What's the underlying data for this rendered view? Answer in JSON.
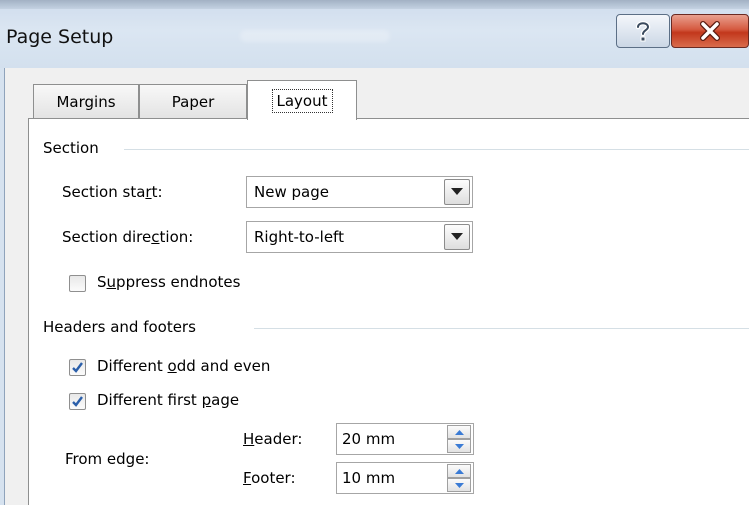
{
  "window": {
    "title": "Page Setup",
    "help_glyph": "?",
    "close_glyph": "X",
    "icons": {
      "help": "help-icon",
      "close": "close-icon"
    },
    "colors": {
      "accent": "#d55a40",
      "titlebar": "#d6e2ef",
      "check": "#2b5faa"
    }
  },
  "tabs": [
    {
      "label": "Margins",
      "active": false
    },
    {
      "label": "Paper",
      "active": false
    },
    {
      "label": "Layout",
      "active": true
    }
  ],
  "section": {
    "heading": "Section",
    "start": {
      "label_pre": "Section sta",
      "label_key": "r",
      "label_post": "t:",
      "value": "New page"
    },
    "direction": {
      "label_pre": "Section dire",
      "label_key": "c",
      "label_post": "tion:",
      "value": "Right-to-left"
    },
    "suppress": {
      "label_pre": "S",
      "label_key": "u",
      "label_post": "ppress endnotes",
      "checked": false
    }
  },
  "headers_footers": {
    "heading": "Headers and footers",
    "odd_even": {
      "label_pre": "Different ",
      "label_key": "o",
      "label_post": "dd and even",
      "checked": true
    },
    "first_page": {
      "label_pre": "Different first ",
      "label_key": "p",
      "label_post": "age",
      "checked": true
    },
    "from_edge_label": "From edge:",
    "header": {
      "label_key": "H",
      "label_post": "eader:",
      "value": "20 mm"
    },
    "footer": {
      "label_key": "F",
      "label_post": "ooter:",
      "value": "10 mm"
    }
  }
}
